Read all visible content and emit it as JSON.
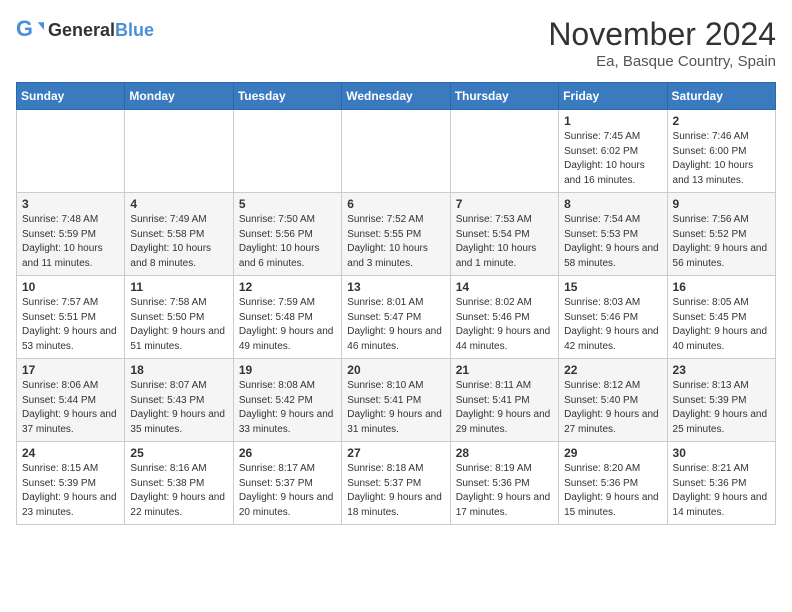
{
  "header": {
    "logo_general": "General",
    "logo_blue": "Blue",
    "title": "November 2024",
    "location": "Ea, Basque Country, Spain"
  },
  "days_of_week": [
    "Sunday",
    "Monday",
    "Tuesday",
    "Wednesday",
    "Thursday",
    "Friday",
    "Saturday"
  ],
  "weeks": [
    [
      {
        "day": "",
        "info": ""
      },
      {
        "day": "",
        "info": ""
      },
      {
        "day": "",
        "info": ""
      },
      {
        "day": "",
        "info": ""
      },
      {
        "day": "",
        "info": ""
      },
      {
        "day": "1",
        "info": "Sunrise: 7:45 AM\nSunset: 6:02 PM\nDaylight: 10 hours and 16 minutes."
      },
      {
        "day": "2",
        "info": "Sunrise: 7:46 AM\nSunset: 6:00 PM\nDaylight: 10 hours and 13 minutes."
      }
    ],
    [
      {
        "day": "3",
        "info": "Sunrise: 7:48 AM\nSunset: 5:59 PM\nDaylight: 10 hours and 11 minutes."
      },
      {
        "day": "4",
        "info": "Sunrise: 7:49 AM\nSunset: 5:58 PM\nDaylight: 10 hours and 8 minutes."
      },
      {
        "day": "5",
        "info": "Sunrise: 7:50 AM\nSunset: 5:56 PM\nDaylight: 10 hours and 6 minutes."
      },
      {
        "day": "6",
        "info": "Sunrise: 7:52 AM\nSunset: 5:55 PM\nDaylight: 10 hours and 3 minutes."
      },
      {
        "day": "7",
        "info": "Sunrise: 7:53 AM\nSunset: 5:54 PM\nDaylight: 10 hours and 1 minute."
      },
      {
        "day": "8",
        "info": "Sunrise: 7:54 AM\nSunset: 5:53 PM\nDaylight: 9 hours and 58 minutes."
      },
      {
        "day": "9",
        "info": "Sunrise: 7:56 AM\nSunset: 5:52 PM\nDaylight: 9 hours and 56 minutes."
      }
    ],
    [
      {
        "day": "10",
        "info": "Sunrise: 7:57 AM\nSunset: 5:51 PM\nDaylight: 9 hours and 53 minutes."
      },
      {
        "day": "11",
        "info": "Sunrise: 7:58 AM\nSunset: 5:50 PM\nDaylight: 9 hours and 51 minutes."
      },
      {
        "day": "12",
        "info": "Sunrise: 7:59 AM\nSunset: 5:48 PM\nDaylight: 9 hours and 49 minutes."
      },
      {
        "day": "13",
        "info": "Sunrise: 8:01 AM\nSunset: 5:47 PM\nDaylight: 9 hours and 46 minutes."
      },
      {
        "day": "14",
        "info": "Sunrise: 8:02 AM\nSunset: 5:46 PM\nDaylight: 9 hours and 44 minutes."
      },
      {
        "day": "15",
        "info": "Sunrise: 8:03 AM\nSunset: 5:46 PM\nDaylight: 9 hours and 42 minutes."
      },
      {
        "day": "16",
        "info": "Sunrise: 8:05 AM\nSunset: 5:45 PM\nDaylight: 9 hours and 40 minutes."
      }
    ],
    [
      {
        "day": "17",
        "info": "Sunrise: 8:06 AM\nSunset: 5:44 PM\nDaylight: 9 hours and 37 minutes."
      },
      {
        "day": "18",
        "info": "Sunrise: 8:07 AM\nSunset: 5:43 PM\nDaylight: 9 hours and 35 minutes."
      },
      {
        "day": "19",
        "info": "Sunrise: 8:08 AM\nSunset: 5:42 PM\nDaylight: 9 hours and 33 minutes."
      },
      {
        "day": "20",
        "info": "Sunrise: 8:10 AM\nSunset: 5:41 PM\nDaylight: 9 hours and 31 minutes."
      },
      {
        "day": "21",
        "info": "Sunrise: 8:11 AM\nSunset: 5:41 PM\nDaylight: 9 hours and 29 minutes."
      },
      {
        "day": "22",
        "info": "Sunrise: 8:12 AM\nSunset: 5:40 PM\nDaylight: 9 hours and 27 minutes."
      },
      {
        "day": "23",
        "info": "Sunrise: 8:13 AM\nSunset: 5:39 PM\nDaylight: 9 hours and 25 minutes."
      }
    ],
    [
      {
        "day": "24",
        "info": "Sunrise: 8:15 AM\nSunset: 5:39 PM\nDaylight: 9 hours and 23 minutes."
      },
      {
        "day": "25",
        "info": "Sunrise: 8:16 AM\nSunset: 5:38 PM\nDaylight: 9 hours and 22 minutes."
      },
      {
        "day": "26",
        "info": "Sunrise: 8:17 AM\nSunset: 5:37 PM\nDaylight: 9 hours and 20 minutes."
      },
      {
        "day": "27",
        "info": "Sunrise: 8:18 AM\nSunset: 5:37 PM\nDaylight: 9 hours and 18 minutes."
      },
      {
        "day": "28",
        "info": "Sunrise: 8:19 AM\nSunset: 5:36 PM\nDaylight: 9 hours and 17 minutes."
      },
      {
        "day": "29",
        "info": "Sunrise: 8:20 AM\nSunset: 5:36 PM\nDaylight: 9 hours and 15 minutes."
      },
      {
        "day": "30",
        "info": "Sunrise: 8:21 AM\nSunset: 5:36 PM\nDaylight: 9 hours and 14 minutes."
      }
    ]
  ]
}
